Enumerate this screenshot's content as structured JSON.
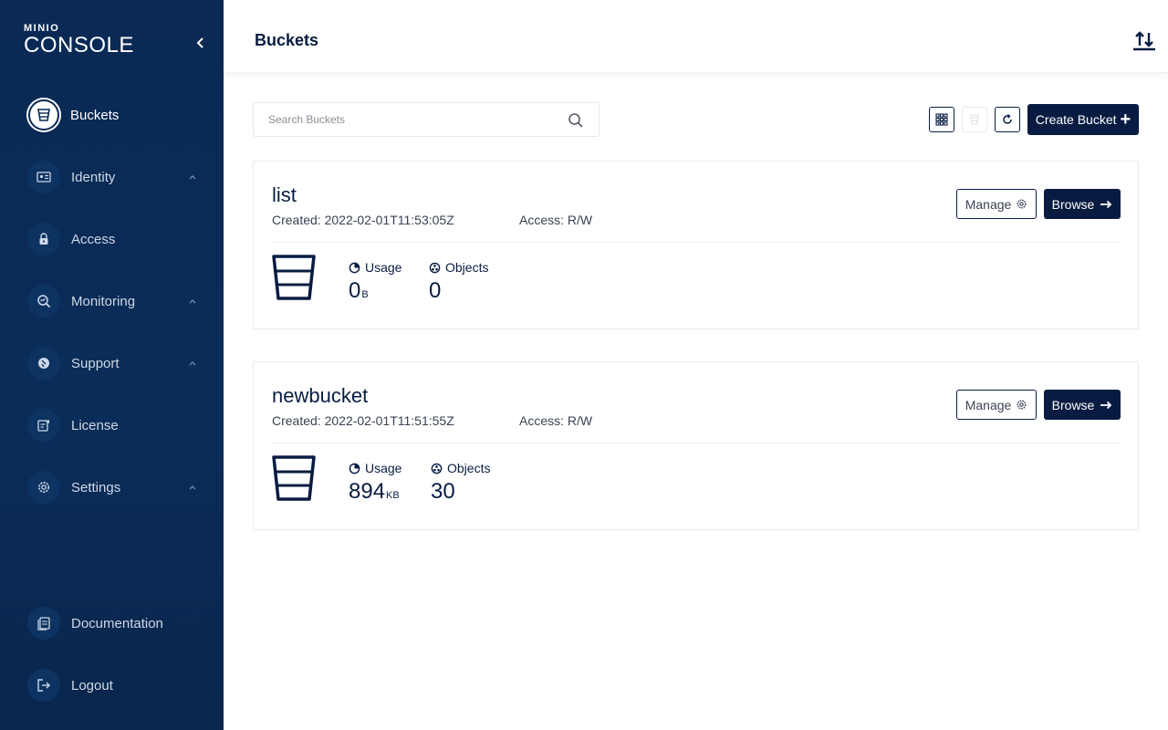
{
  "sidebar": {
    "logo_small": "MINIO",
    "logo_big": "CONSOLE",
    "items": [
      {
        "label": "Buckets",
        "icon": "bucket-icon",
        "active": true
      },
      {
        "label": "Identity",
        "icon": "id-card-icon",
        "expandable": true
      },
      {
        "label": "Access",
        "icon": "lock-icon"
      },
      {
        "label": "Monitoring",
        "icon": "magnifier-chart-icon",
        "expandable": true
      },
      {
        "label": "Support",
        "icon": "support-icon",
        "expandable": true
      },
      {
        "label": "License",
        "icon": "license-icon"
      },
      {
        "label": "Settings",
        "icon": "gear-icon",
        "expandable": true
      }
    ],
    "bottom_items": [
      {
        "label": "Documentation",
        "icon": "documentation-icon"
      },
      {
        "label": "Logout",
        "icon": "logout-icon"
      }
    ]
  },
  "header": {
    "title": "Buckets"
  },
  "toolbar": {
    "search_placeholder": "Search Buckets",
    "create_label": "Create Bucket",
    "create_plus": "+"
  },
  "buckets": [
    {
      "name": "list",
      "created": "Created: 2022-02-01T11:53:05Z",
      "access": "Access: R/W",
      "manage_label": "Manage",
      "browse_label": "Browse",
      "usage_label": "Usage",
      "usage_value": "0",
      "usage_unit": "B",
      "objects_label": "Objects",
      "objects_value": "0"
    },
    {
      "name": "newbucket",
      "created": "Created: 2022-02-01T11:51:55Z",
      "access": "Access: R/W",
      "manage_label": "Manage",
      "browse_label": "Browse",
      "usage_label": "Usage",
      "usage_value": "894",
      "usage_unit": "KB",
      "objects_label": "Objects",
      "objects_value": "30"
    }
  ],
  "colors": {
    "sidebar_bg": "#0a2a55",
    "primary": "#081c42",
    "border": "#e8eaee"
  }
}
